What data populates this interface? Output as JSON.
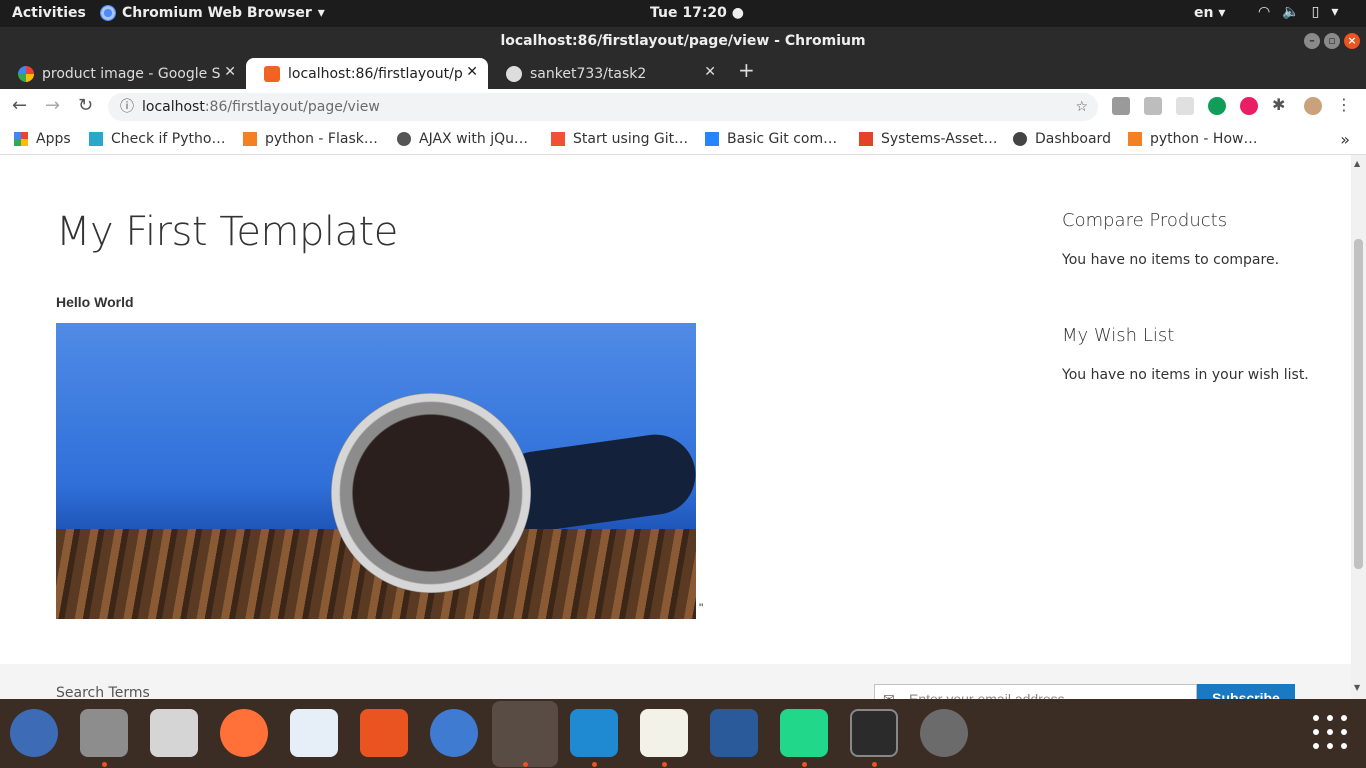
{
  "topbar": {
    "activities": "Activities",
    "app_name": "Chromium Web Browser",
    "clock": "Tue 17:20",
    "language": "en"
  },
  "window": {
    "title": "localhost:86/firstlayout/page/view - Chromium"
  },
  "tabs": [
    {
      "title": "product image - Google Se",
      "favicon": "google-icon"
    },
    {
      "title": "localhost:86/firstlayout/p",
      "favicon": "magento-icon",
      "active": true
    },
    {
      "title": "sanket733/task2",
      "favicon": "github-icon"
    }
  ],
  "toolbar": {
    "url_host": "localhost",
    "url_path": ":86/firstlayout/page/view"
  },
  "bookmarks": [
    {
      "label": "Apps",
      "icon": "apps-grid-icon"
    },
    {
      "label": "Check if Pytho…",
      "icon": "site-icon"
    },
    {
      "label": "python - Flask…",
      "icon": "stackoverflow-icon"
    },
    {
      "label": "AJAX with jQu…",
      "icon": "site-icon"
    },
    {
      "label": "Start using Git…",
      "icon": "git-icon"
    },
    {
      "label": "Basic Git com…",
      "icon": "atlassian-icon"
    },
    {
      "label": "Systems-Asset…",
      "icon": "gitlab-icon"
    },
    {
      "label": "Dashboard",
      "icon": "globe-icon"
    },
    {
      "label": "python - How…",
      "icon": "stackoverflow-icon"
    }
  ],
  "page": {
    "title": "My First Template",
    "hello": "Hello World",
    "quote_mark": "\"",
    "compare": {
      "heading": "Compare Products",
      "text": "You have no items to compare."
    },
    "wishlist": {
      "heading": "My Wish List",
      "text": "You have no items in your wish list."
    },
    "footer": {
      "search_terms": "Search Terms",
      "email_placeholder": "Enter your email address",
      "subscribe": "Subscribe"
    }
  },
  "colors": {
    "accent": "#e95420",
    "subscribe": "#1979c3"
  }
}
